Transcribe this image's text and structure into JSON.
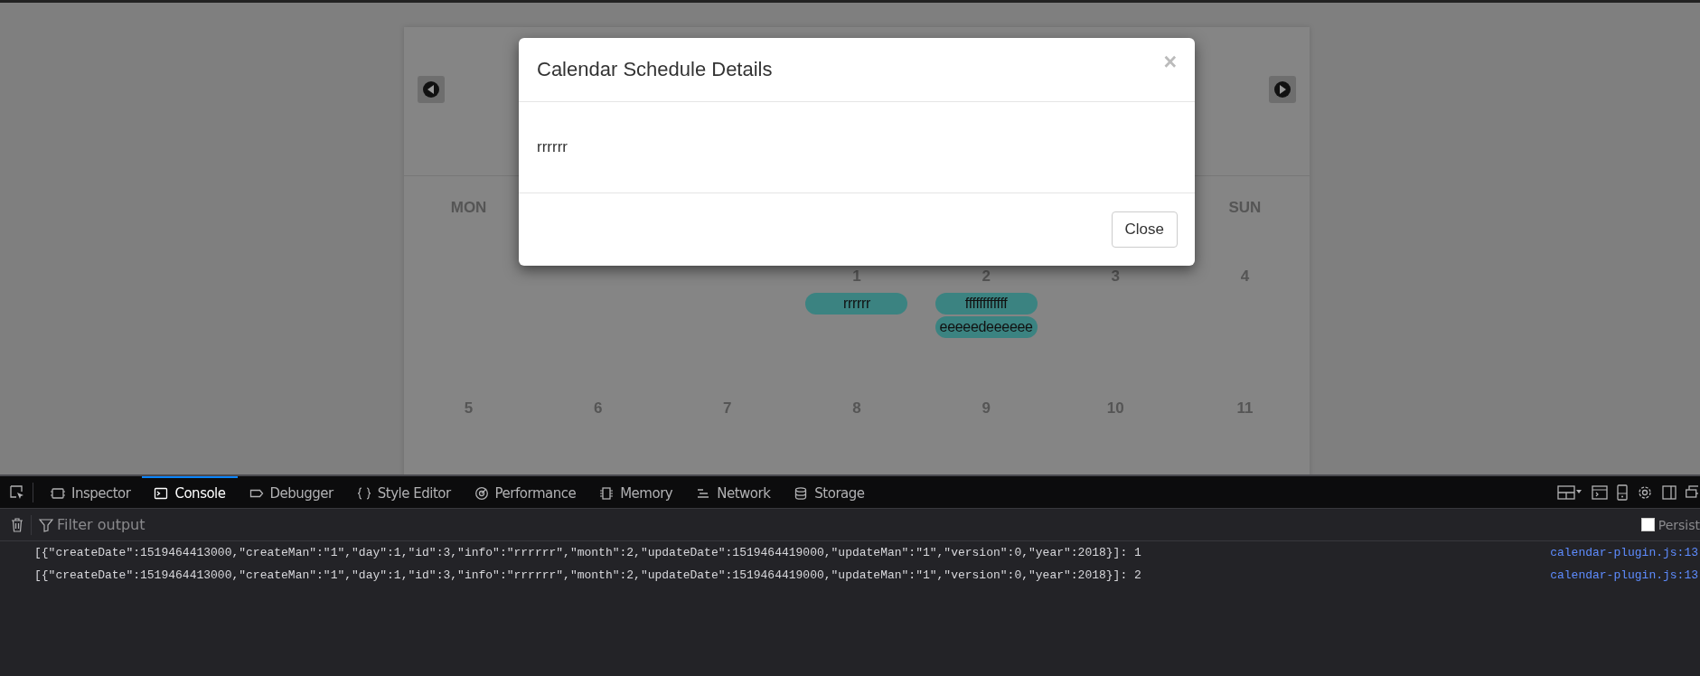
{
  "calendar": {
    "weekdays": [
      {
        "label": "MON",
        "kind": "first"
      },
      {
        "label": "SUN",
        "kind": "last"
      }
    ],
    "weeks": [
      {
        "days": [
          {
            "kind": "empty"
          },
          {
            "kind": "empty"
          },
          {
            "kind": "empty"
          },
          {
            "kind": "date",
            "date": "1",
            "events": [
              "rrrrrr"
            ]
          },
          {
            "kind": "date",
            "date": "2",
            "events": [
              "ffffffffffff",
              "eeeeedeeeeee"
            ]
          },
          {
            "kind": "date",
            "date": "3"
          },
          {
            "kind": "date",
            "date": "4"
          }
        ]
      },
      {
        "days": [
          {
            "kind": "date",
            "date": "5"
          },
          {
            "kind": "date",
            "date": "6"
          },
          {
            "kind": "date",
            "date": "7"
          },
          {
            "kind": "date",
            "date": "8"
          },
          {
            "kind": "date",
            "date": "9"
          },
          {
            "kind": "date",
            "date": "10"
          },
          {
            "kind": "date",
            "date": "11"
          }
        ]
      }
    ]
  },
  "modal": {
    "title": "Calendar Schedule Details",
    "close": "×",
    "body": "rrrrrr",
    "button": "Close"
  },
  "devtools": {
    "tabs": [
      {
        "label": "Inspector",
        "selected": false
      },
      {
        "label": "Console",
        "selected": true
      },
      {
        "label": "Debugger",
        "selected": false
      },
      {
        "label": "Style Editor",
        "selected": false
      },
      {
        "label": "Performance",
        "selected": false
      },
      {
        "label": "Memory",
        "selected": false
      },
      {
        "label": "Network",
        "selected": false
      },
      {
        "label": "Storage",
        "selected": false
      }
    ],
    "filter": {
      "placeholder": "Filter output"
    },
    "persist": {
      "label": "Persist",
      "checked": false
    },
    "messages": [
      {
        "text": "[{\"createDate\":1519464413000,\"createMan\":\"1\",\"day\":1,\"id\":3,\"info\":\"rrrrrr\",\"month\":2,\"updateDate\":1519464419000,\"updateMan\":\"1\",\"version\":0,\"year\":2018}]: 1",
        "source": "calendar-plugin.js:13"
      },
      {
        "text": "[{\"createDate\":1519464413000,\"createMan\":\"1\",\"day\":1,\"id\":3,\"info\":\"rrrrrr\",\"month\":2,\"updateDate\":1519464419000,\"updateMan\":\"1\",\"version\":0,\"year\":2018}]: 2",
        "source": "calendar-plugin.js:13"
      }
    ]
  }
}
